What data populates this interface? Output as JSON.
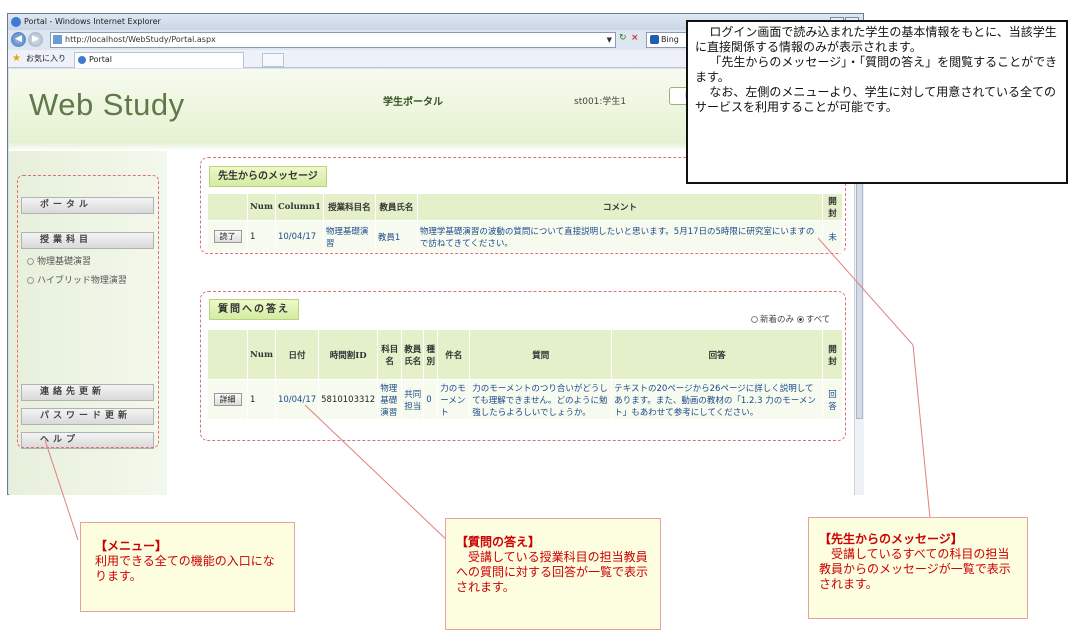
{
  "browser": {
    "title": "Portal - Windows Internet Explorer",
    "url": "http://localhost/WebStudy/Portal.aspx",
    "search_engine": "Bing",
    "favorites_label": "お気に入り",
    "tab_label": "Portal"
  },
  "header": {
    "logo": "Web Study",
    "title": "学生ポータル",
    "user": "st001:学生1",
    "button": "ロ"
  },
  "sidebar": {
    "portal": "ポータル",
    "courses": "授業科目",
    "course_items": [
      "物理基礎演習",
      "ハイブリッド物理演習"
    ],
    "contact_update": "連絡先更新",
    "password_update": "パスワード更新",
    "help": "ヘルプ"
  },
  "messages": {
    "title": "先生からのメッセージ",
    "headers": [
      "",
      "Num",
      "Column1",
      "授業科目名",
      "教員氏名",
      "コメント",
      "開封"
    ],
    "rows": [
      {
        "button": "読了",
        "num": "1",
        "date": "10/04/17",
        "course": "物理基礎演習",
        "teacher": "教員1",
        "comment": "物理学基礎演習の波動の質問について直接説明したいと思います。5月17日の5時限に研究室にいますので訪ねてきてください。",
        "opened": "未"
      }
    ]
  },
  "answers": {
    "title": "質問への答え",
    "filter_new": "新着のみ",
    "filter_all": "すべて",
    "headers": [
      "",
      "Num",
      "日付",
      "時間割ID",
      "科目名",
      "教員氏名",
      "種別",
      "件名",
      "質問",
      "回答",
      "開封"
    ],
    "rows": [
      {
        "button": "詳細",
        "num": "1",
        "date": "10/04/17",
        "timetable_id": "5810103312",
        "course": "物理基礎演習",
        "teacher": "共同担当",
        "type": "0",
        "subject": "力のモーメント",
        "question": "力のモーメントのつり合いがどうしても理解できません。どのように勉強したらよろしいでしょうか。",
        "answer": "テキストの20ページから26ページに詳しく説明してあります。また、動画の教材の「1.2.3 力のモーメント」もあわせて参考にしてください。",
        "opened": "回答"
      }
    ]
  },
  "callout": {
    "p1": "ログイン画面で読み込まれた学生の基本情報をもとに、当該学生に直接関係する情報のみが表示されます。",
    "p2": "「先生からのメッセージ」・「質問の答え」を閲覧することができます。",
    "p3": "なお、左側のメニューより、学生に対して用意されている全てのサービスを利用することが可能です。"
  },
  "notes": {
    "menu": {
      "title": "【メニュー】",
      "body": "利用できる全ての機能の入口になります。"
    },
    "answers": {
      "title": "【質問の答え】",
      "body": "受講している授業科目の担当教員への質問に対する回答が一覧で表示されます。"
    },
    "messages": {
      "title": "【先生からのメッセージ】",
      "body": "受講しているすべての科目の担当教員からのメッセージが一覧で表示されます。"
    }
  }
}
